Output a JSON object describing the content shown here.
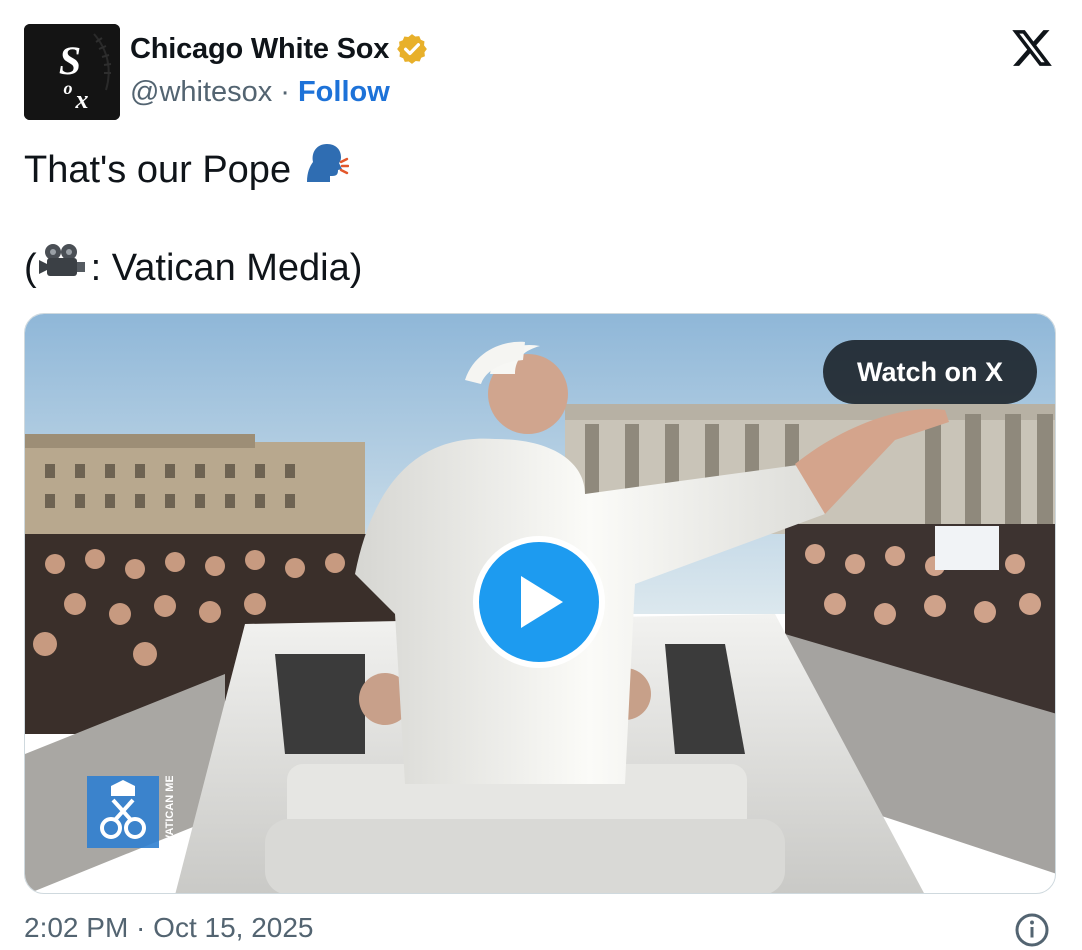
{
  "author": {
    "display_name": "Chicago White Sox",
    "handle": "@whitesox",
    "separator": "·",
    "follow_label": "Follow",
    "verified_icon": "verified-badge-icon",
    "avatar_text": "SOX"
  },
  "tweet": {
    "line1": "That's our Pope",
    "line1_emoji": "🗣️",
    "line2_open": "(",
    "line2_emoji": "🎥",
    "line2_rest": ": Vatican Media)"
  },
  "media": {
    "watch_label": "Watch on X",
    "play_icon": "play-icon",
    "watermark_text": "VATICAN MEDIA"
  },
  "footer": {
    "timestamp": "2:02 PM · Oct 15, 2025",
    "info_icon": "info-icon"
  },
  "colors": {
    "accent": "#1d9bf0",
    "follow": "#1d72d8",
    "verified": "#e8b02a",
    "text_secondary": "#536471"
  }
}
